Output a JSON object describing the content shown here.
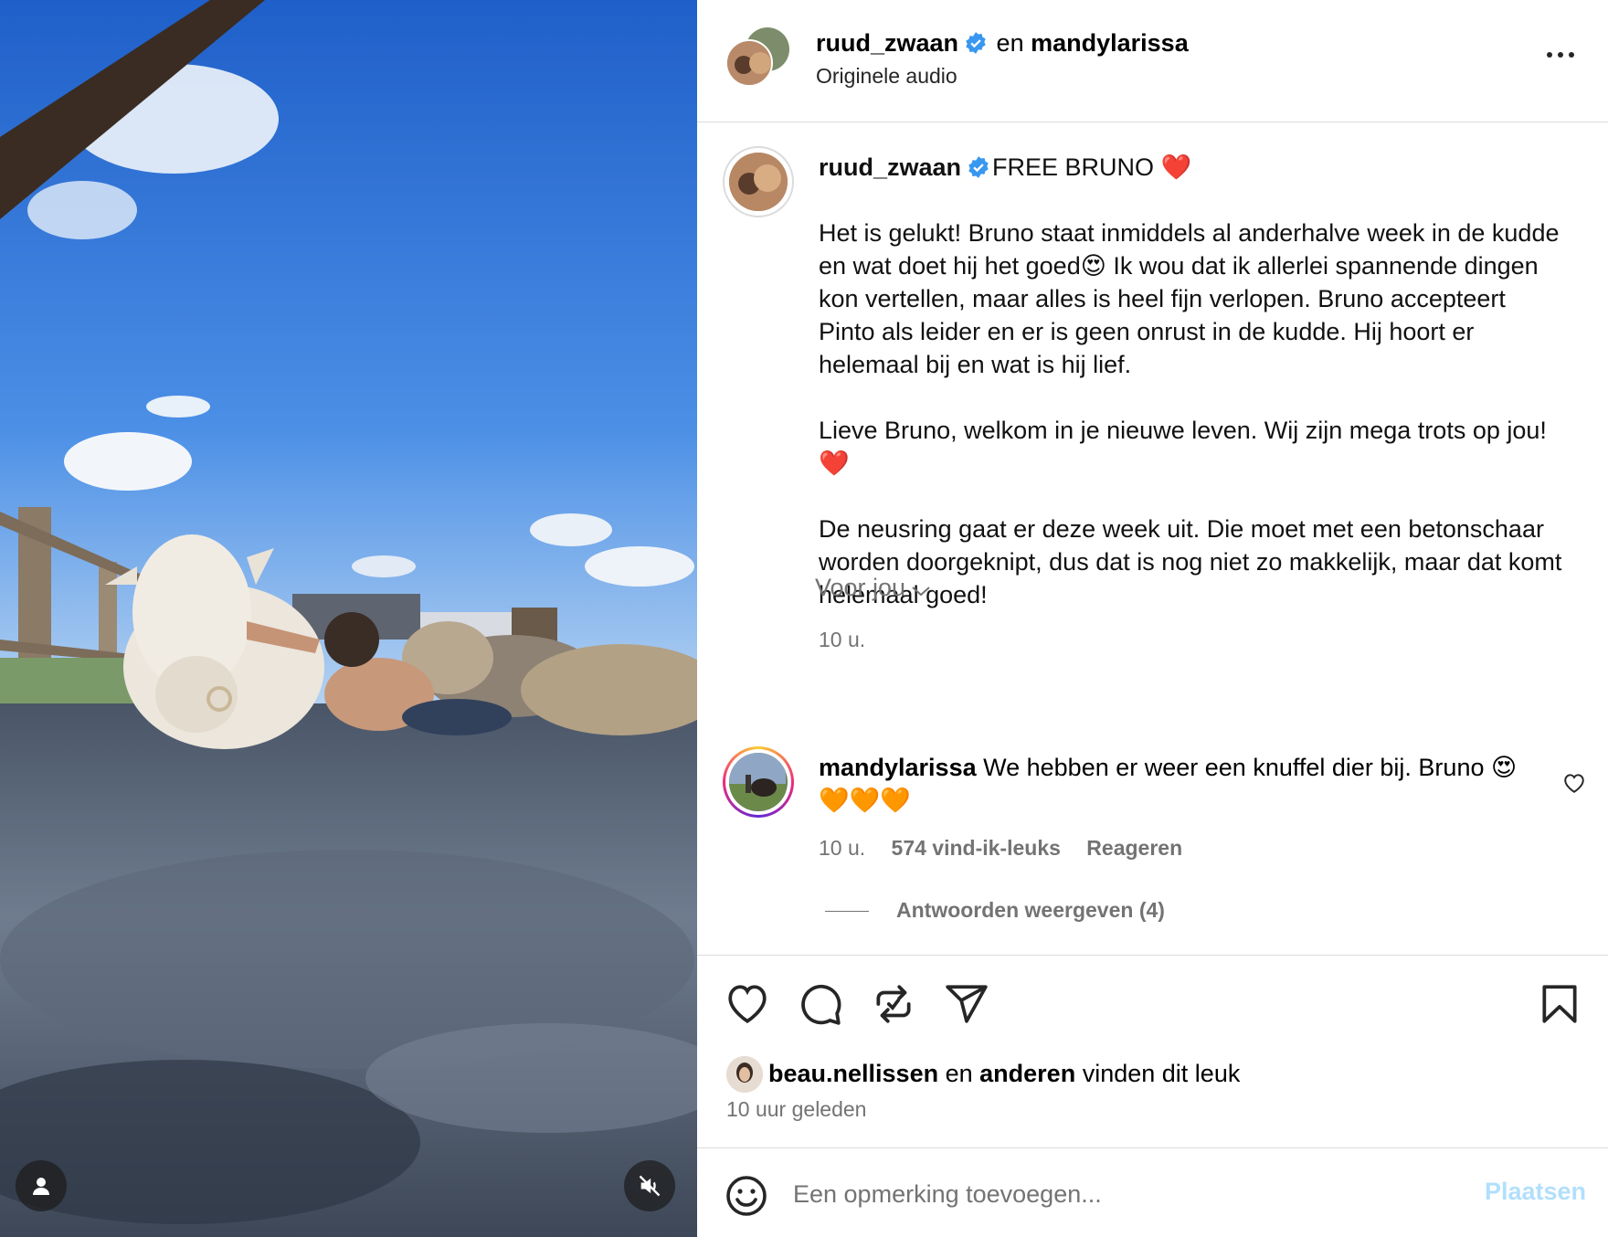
{
  "header": {
    "user1": "ruud_zwaan",
    "conj": "en",
    "user2": "mandylarissa",
    "audio": "Originele audio"
  },
  "caption": {
    "username": "ruud_zwaan",
    "headline": "FREE BRUNO ❤️",
    "paragraphs": [
      "Het is gelukt! Bruno staat inmiddels al anderhalve week in de kudde en wat doet hij het goed😍 Ik wou dat ik allerlei spannende dingen kon vertellen, maar alles is heel fijn verlopen. Bruno accepteert Pinto als leider en er is geen onrust in de kudde. Hij hoort er helemaal bij en wat is hij lief.",
      "Lieve Bruno, welkom in je nieuwe leven. Wij zijn mega trots op jou! ❤️",
      "De neusring gaat er deze week uit. Die moet met een betonschaar worden doorgeknipt, dus dat is nog niet zo makkelijk, maar dat komt helemaal goed!"
    ],
    "time": "10 u."
  },
  "for_you": "Voor jou",
  "comment": {
    "username": "mandylarissa",
    "text": "We hebben er weer een knuffel dier bij. Bruno 😍🧡🧡🧡",
    "time": "10 u.",
    "likes": "574 vind-ik-leuks",
    "reply": "Reageren",
    "view_replies": "Antwoorden weergeven (4)"
  },
  "likes_row": {
    "user": "beau.nellissen",
    "conj": "en",
    "others": "anderen",
    "suffix": "vinden dit leuk"
  },
  "posted_ago": "10 uur geleden",
  "add_comment": {
    "placeholder": "Een opmerking toevoegen...",
    "post_label": "Plaatsen"
  },
  "colors": {
    "verified": "#3897f0",
    "post_disabled": "#b2dffc",
    "secondary_text": "#737373",
    "heart_red": "#ed4956"
  },
  "icons": [
    "user-tag-icon",
    "muted-speaker-icon",
    "more-icon",
    "verified-badge-icon",
    "chevron-down-icon",
    "heart-icon",
    "comment-icon",
    "repost-icon",
    "share-icon",
    "bookmark-icon",
    "emoji-icon"
  ]
}
